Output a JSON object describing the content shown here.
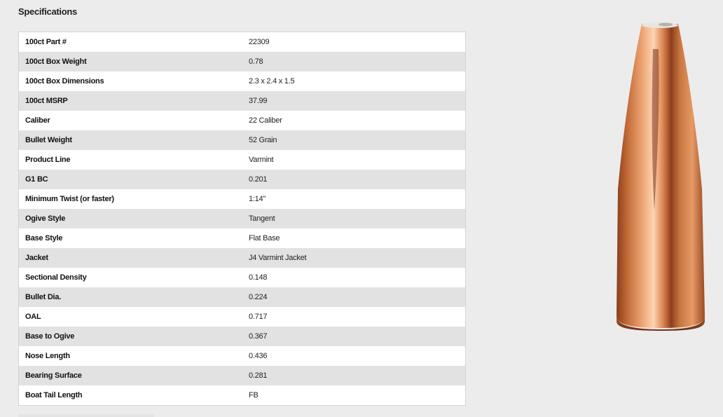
{
  "section": {
    "title": "Specifications"
  },
  "specs": [
    {
      "label": "100ct Part #",
      "value": "22309"
    },
    {
      "label": "100ct Box Weight",
      "value": "0.78"
    },
    {
      "label": "100ct Box Dimensions",
      "value": "2.3 x 2.4 x 1.5"
    },
    {
      "label": "100ct MSRP",
      "value": "37.99"
    },
    {
      "label": "Caliber",
      "value": "22 Caliber"
    },
    {
      "label": "Bullet Weight",
      "value": "52 Grain"
    },
    {
      "label": "Product Line",
      "value": "Varmint"
    },
    {
      "label": "G1 BC",
      "value": "0.201"
    },
    {
      "label": "Minimum Twist (or faster)",
      "value": "1:14\""
    },
    {
      "label": "Ogive Style",
      "value": "Tangent"
    },
    {
      "label": "Base Style",
      "value": "Flat Base"
    },
    {
      "label": "Jacket",
      "value": "J4 Varmint Jacket"
    },
    {
      "label": "Sectional Density",
      "value": "0.148"
    },
    {
      "label": "Bullet Dia.",
      "value": "0.224"
    },
    {
      "label": "OAL",
      "value": "0.717"
    },
    {
      "label": "Base to Ogive",
      "value": "0.367"
    },
    {
      "label": "Nose Length",
      "value": "0.436"
    },
    {
      "label": "Bearing Surface",
      "value": "0.281"
    },
    {
      "label": "Boat Tail Length",
      "value": "FB"
    }
  ],
  "colors": {
    "background": "#ececec",
    "row_alt": "#e2e2e2",
    "row": "#ffffff",
    "bullet_copper": "#c26a36"
  },
  "image": {
    "icon": "bullet-product-image"
  }
}
